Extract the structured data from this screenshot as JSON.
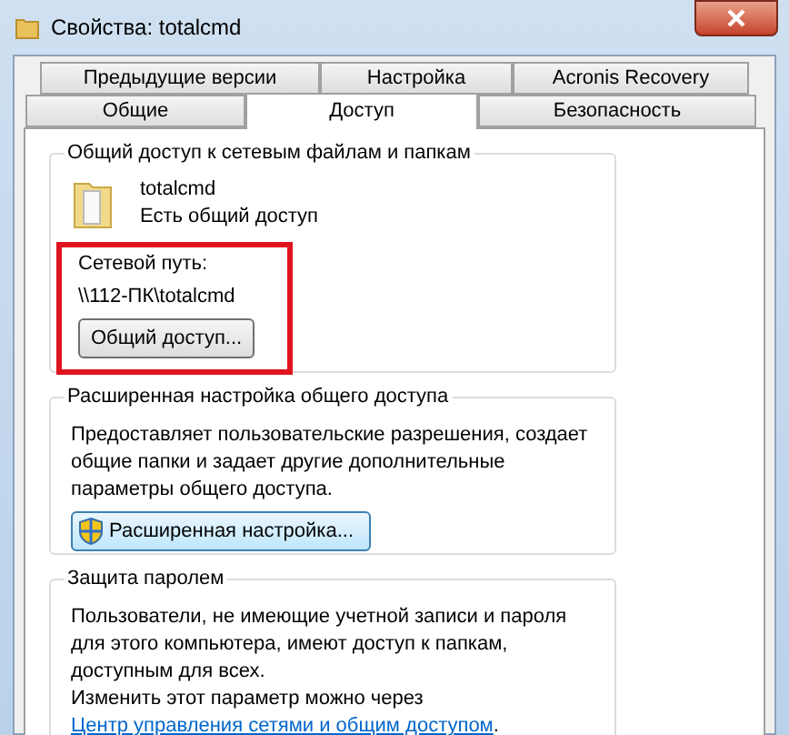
{
  "window": {
    "title": "Свойства: totalcmd"
  },
  "tab_rows": [
    [
      {
        "label": "Предыдущие версии",
        "selected": false
      },
      {
        "label": "Настройка",
        "selected": false
      },
      {
        "label": "Acronis Recovery",
        "selected": false
      }
    ],
    [
      {
        "label": "Общие",
        "selected": false
      },
      {
        "label": "Доступ",
        "selected": true
      },
      {
        "label": "Безопасность",
        "selected": false
      }
    ]
  ],
  "network_sharing": {
    "title": "Общий доступ к сетевым файлам и папкам",
    "name": "totalcmd",
    "status": "Есть общий доступ",
    "path_label": "Сетевой путь:",
    "path": "\\\\112-ПК\\totalcmd",
    "button": "Общий доступ..."
  },
  "advanced_sharing": {
    "title": "Расширенная настройка общего доступа",
    "description": "Предоставляет пользовательские разрешения, создает общие папки и задает другие дополнительные параметры общего доступа.",
    "button": "Расширенная настройка..."
  },
  "password_protection": {
    "title": "Защита паролем",
    "description": "Пользователи, не имеющие учетной записи и пароля для этого компьютера, имеют доступ к папкам, доступным для всех.",
    "change_text": "Изменить этот параметр можно через",
    "link": "Центр управления сетями и общим доступом",
    "after_link": "."
  }
}
